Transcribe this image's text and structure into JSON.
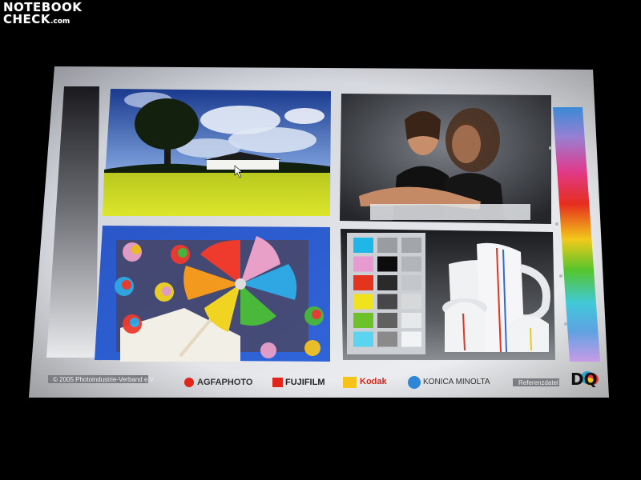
{
  "watermark": {
    "line1": "NOTEBOOK",
    "line2": "CHECK",
    "suffix": ".com"
  },
  "chart": {
    "copyright": "© 2005 Photoindustrie-Verband e.V.",
    "reference_label": "Referenzdatei",
    "brands": [
      "AGFAPHOTO",
      "FUJIFILM",
      "Kodak",
      "KONICA MINOLTA"
    ],
    "logo": "DQ"
  },
  "colors": {
    "swatches": [
      "#1fb6e8",
      "#e89ad0",
      "#e5341d",
      "#f0e21c",
      "#6dc22a",
      "#5ad4ef"
    ],
    "grays": [
      "#9a9da0",
      "#0c0c0c",
      "#2a2a2a",
      "#474747",
      "#606060",
      "#8a8a8a"
    ],
    "light_grays": [
      "#a2a6aa",
      "#b2b6ba",
      "#c4c7ca",
      "#d6d8da",
      "#e6e8ea",
      "#f2f3f4"
    ]
  }
}
